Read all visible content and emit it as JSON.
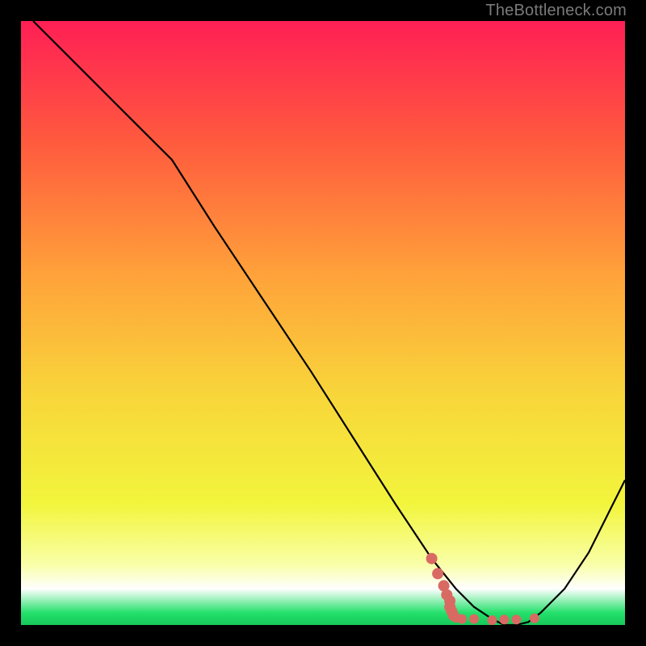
{
  "watermark": "TheBottleneck.com",
  "chart_data": {
    "type": "line",
    "title": "",
    "xlabel": "",
    "ylabel": "",
    "xlim": [
      0,
      100
    ],
    "ylim": [
      0,
      100
    ],
    "grid": false,
    "legend": false,
    "series": [
      {
        "name": "curve",
        "color": "#000000",
        "x": [
          2,
          10,
          18,
          25,
          32,
          40,
          48,
          55,
          62,
          68,
          72,
          75,
          78,
          80,
          82,
          84,
          86,
          90,
          94,
          98,
          100
        ],
        "y": [
          100,
          92,
          84,
          77,
          66,
          54,
          42,
          31,
          20,
          11,
          6,
          3,
          1,
          0,
          0,
          0.5,
          2,
          6,
          12,
          20,
          24
        ]
      },
      {
        "name": "highlight-dots",
        "color": "#d96a63",
        "style": "dots",
        "x": [
          68,
          69,
          70,
          70.5,
          71,
          71,
          71.3,
          71.6,
          72,
          73,
          75,
          78,
          80,
          82,
          85
        ],
        "y": [
          11,
          8.5,
          6.5,
          5,
          4,
          3,
          2.3,
          1.6,
          1.2,
          1,
          1,
          0.8,
          0.9,
          0.9,
          1.1
        ]
      }
    ],
    "background_gradient": {
      "type": "vertical",
      "stops": [
        {
          "pos": 0.0,
          "color": "#ff1f55"
        },
        {
          "pos": 0.2,
          "color": "#ff5a3e"
        },
        {
          "pos": 0.42,
          "color": "#ffa23a"
        },
        {
          "pos": 0.62,
          "color": "#f8d63a"
        },
        {
          "pos": 0.8,
          "color": "#f2f53c"
        },
        {
          "pos": 0.9,
          "color": "#f9ffa8"
        },
        {
          "pos": 0.94,
          "color": "#ffffff"
        },
        {
          "pos": 0.98,
          "color": "#23e06a"
        },
        {
          "pos": 1.0,
          "color": "#17c85a"
        }
      ]
    }
  }
}
